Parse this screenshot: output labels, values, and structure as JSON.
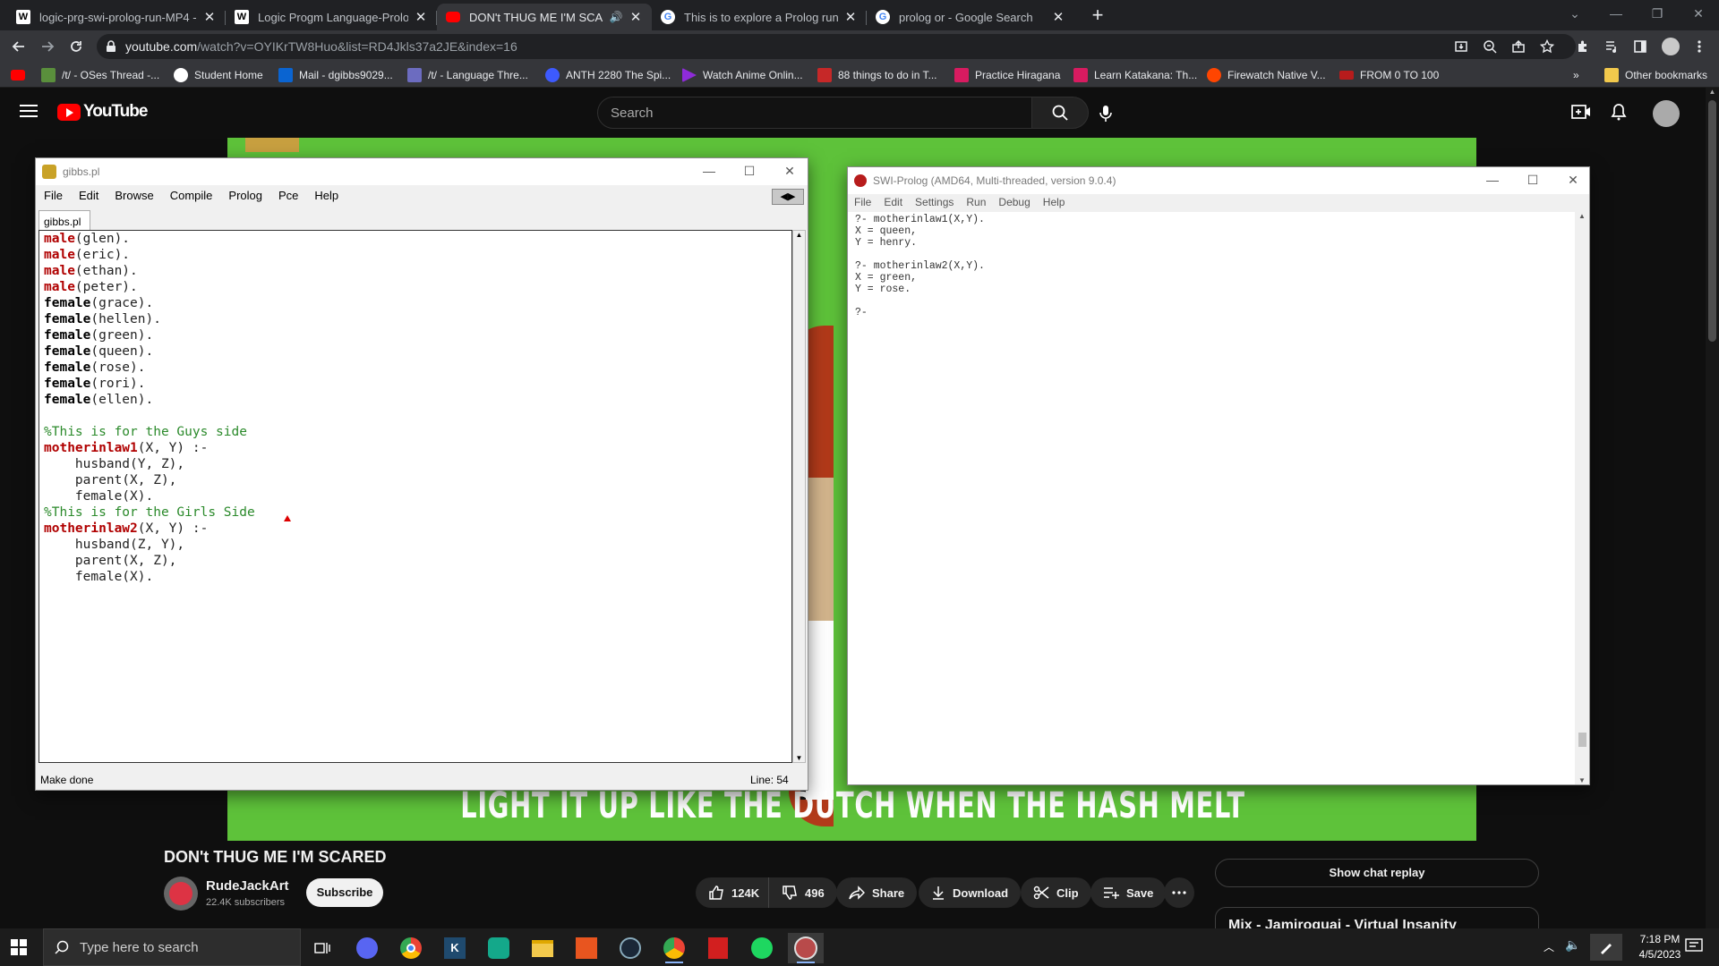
{
  "browser": {
    "tabs": [
      {
        "title": "logic-prg-swi-prolog-run-MP4 -",
        "icon": "wordpress-w-icon",
        "active": false
      },
      {
        "title": "Logic Progm Language-Prolog -",
        "icon": "wordpress-w-icon",
        "active": false
      },
      {
        "title": "DON't THUG ME I'M SCARED",
        "icon": "youtube-icon",
        "active": true
      },
      {
        "title": "This is to explore a Prolog runnin",
        "icon": "google-icon",
        "active": false
      },
      {
        "title": "prolog or - Google Search",
        "icon": "google-icon",
        "active": false
      }
    ],
    "url_host": "youtube.com",
    "url_rest": "/watch?v=OYIKrTW8Huo&list=RD4Jkls37a2JE&index=16",
    "bookmarks": [
      {
        "label": "/t/ - OSes Thread -...",
        "icon": "site-icon"
      },
      {
        "label": "Student Home",
        "icon": "github-icon"
      },
      {
        "label": "Mail - dgibbs9029...",
        "icon": "outlook-icon"
      },
      {
        "label": "/t/ - Language Thre...",
        "icon": "site-icon"
      },
      {
        "label": "ANTH 2280 The Spi...",
        "icon": "canvas-icon"
      },
      {
        "label": "Watch Anime Onlin...",
        "icon": "anime-icon"
      },
      {
        "label": "88 things to do in T...",
        "icon": "site-icon"
      },
      {
        "label": "Practice Hiragana",
        "icon": "crown-icon"
      },
      {
        "label": "Learn Katakana: Th...",
        "icon": "crown-icon"
      },
      {
        "label": "Firewatch Native V...",
        "icon": "reddit-icon"
      },
      {
        "label": "FROM 0 TO 100",
        "icon": "site-icon"
      }
    ],
    "other_bookmarks": "Other bookmarks"
  },
  "youtube": {
    "logo_text": "YouTube",
    "search_placeholder": "Search",
    "caption": "LIGHT IT UP LIKE THE DUTCH WHEN THE HASH MELT",
    "video_title": "DON't THUG ME I'M SCARED",
    "channel_name": "RudeJackArt",
    "subscribers": "22.4K subscribers",
    "subscribe_label": "Subscribe",
    "likes": "124K",
    "dislikes": "496",
    "share_label": "Share",
    "download_label": "Download",
    "clip_label": "Clip",
    "save_label": "Save",
    "chat_replay_label": "Show chat replay",
    "mix_title": "Mix - Jamiroquai - Virtual Insanity"
  },
  "editor": {
    "title": "gibbs.pl",
    "menu": [
      "File",
      "Edit",
      "Browse",
      "Compile",
      "Prolog",
      "Pce",
      "Help"
    ],
    "tab_label": "gibbs.pl",
    "status_left": "Make done",
    "status_right": "Line: 54",
    "lines": [
      {
        "pred": "male",
        "style": "kw",
        "rest": "(glen)."
      },
      {
        "pred": "male",
        "style": "kw",
        "rest": "(eric)."
      },
      {
        "pred": "male",
        "style": "kw",
        "rest": "(ethan)."
      },
      {
        "pred": "male",
        "style": "kw",
        "rest": "(peter)."
      },
      {
        "pred": "female",
        "style": "kwb",
        "rest": "(grace)."
      },
      {
        "pred": "female",
        "style": "kwb",
        "rest": "(hellen)."
      },
      {
        "pred": "female",
        "style": "kwb",
        "rest": "(green)."
      },
      {
        "pred": "female",
        "style": "kwb",
        "rest": "(queen)."
      },
      {
        "pred": "female",
        "style": "kwb",
        "rest": "(rose)."
      },
      {
        "pred": "female",
        "style": "kwb",
        "rest": "(rori)."
      },
      {
        "pred": "female",
        "style": "kwb",
        "rest": "(ellen)."
      },
      {
        "pred": "",
        "style": "",
        "rest": ""
      },
      {
        "pred": "%This is for the Guys side",
        "style": "cmt",
        "rest": ""
      },
      {
        "pred": "motherinlaw1",
        "style": "kw",
        "rest": "(X, Y) :-"
      },
      {
        "pred": "",
        "style": "",
        "rest": "    husband(Y, Z),"
      },
      {
        "pred": "",
        "style": "",
        "rest": "    parent(X, Z),"
      },
      {
        "pred": "",
        "style": "",
        "rest": "    female(X)."
      },
      {
        "pred": "%This is for the Girls Side",
        "style": "cmt",
        "rest": ""
      },
      {
        "pred": "motherinlaw2",
        "style": "kw",
        "rest": "(X, Y) :-"
      },
      {
        "pred": "",
        "style": "",
        "rest": "    husband(Z, Y),"
      },
      {
        "pred": "",
        "style": "",
        "rest": "    parent(X, Z),"
      },
      {
        "pred": "",
        "style": "",
        "rest": "    female(X)."
      }
    ]
  },
  "console": {
    "title": "SWI-Prolog (AMD64, Multi-threaded, version 9.0.4)",
    "menu": [
      "File",
      "Edit",
      "Settings",
      "Run",
      "Debug",
      "Help"
    ],
    "lines": [
      "?- motherinlaw1(X,Y).",
      "X = queen,",
      "Y = henry.",
      "",
      "?- motherinlaw2(X,Y).",
      "X = green,",
      "Y = rose.",
      "",
      "?-"
    ]
  },
  "taskbar": {
    "search_placeholder": "Type here to search",
    "time": "7:18 PM",
    "date": "4/5/2023"
  }
}
